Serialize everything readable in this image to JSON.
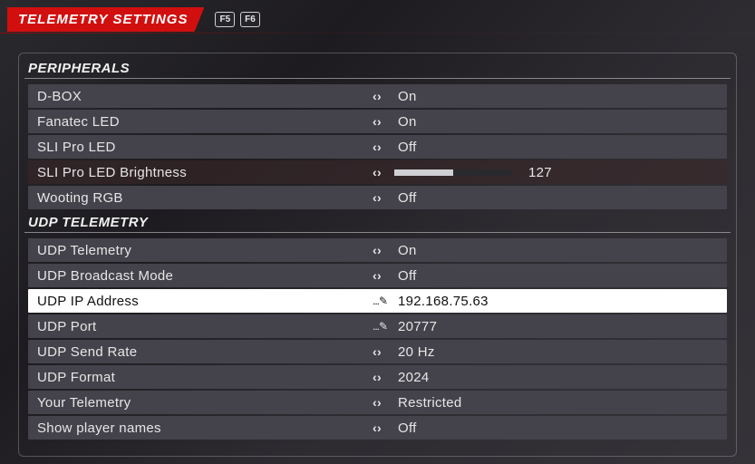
{
  "header": {
    "title": "TELEMETRY SETTINGS",
    "keys": [
      "F5",
      "F6"
    ]
  },
  "sections": {
    "peripherals": {
      "title": "PERIPHERALS",
      "dbox": {
        "label": "D-BOX",
        "value": "On"
      },
      "fanatec": {
        "label": "Fanatec LED",
        "value": "On"
      },
      "slipro": {
        "label": "SLI Pro LED",
        "value": "Off"
      },
      "sliprobri": {
        "label": "SLI Pro LED Brightness",
        "value": "127",
        "slider_pct": 50
      },
      "wooting": {
        "label": "Wooting RGB",
        "value": "Off"
      }
    },
    "udp": {
      "title": "UDP TELEMETRY",
      "telemetry": {
        "label": "UDP Telemetry",
        "value": "On"
      },
      "broadcast": {
        "label": "UDP Broadcast Mode",
        "value": "Off"
      },
      "ip": {
        "label": "UDP IP Address",
        "value": "192.168.75.63"
      },
      "port": {
        "label": "UDP Port",
        "value": "20777"
      },
      "sendrate": {
        "label": "UDP Send Rate",
        "value": "20 Hz"
      },
      "format": {
        "label": "UDP Format",
        "value": "2024"
      },
      "your": {
        "label": "Your Telemetry",
        "value": "Restricted"
      },
      "names": {
        "label": "Show player names",
        "value": "Off"
      }
    }
  }
}
